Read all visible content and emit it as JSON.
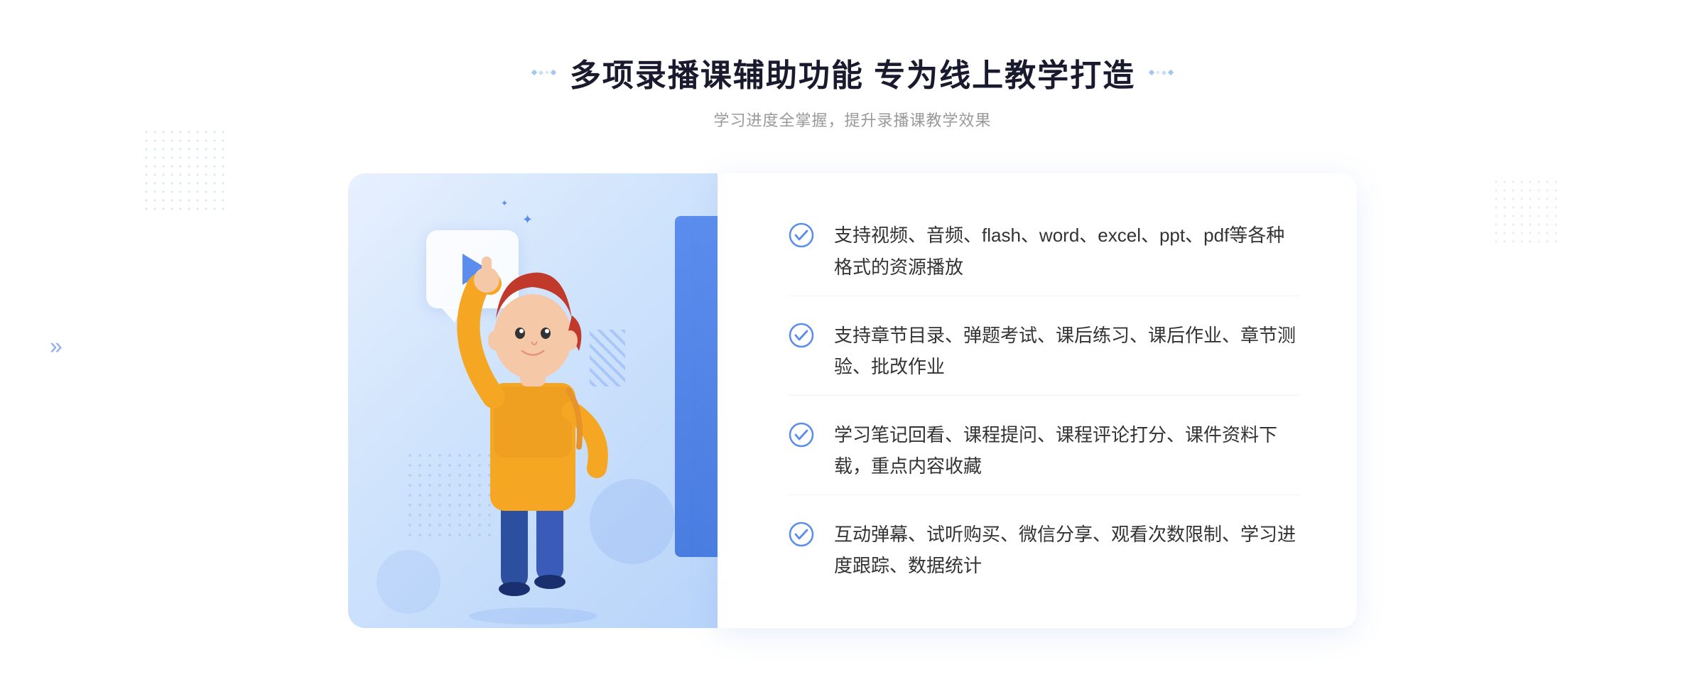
{
  "header": {
    "title": "多项录播课辅助功能 专为线上教学打造",
    "subtitle": "学习进度全掌握，提升录播课教学效果",
    "title_decorator_left": "❖",
    "title_decorator_right": "❖"
  },
  "features": [
    {
      "id": "feature-1",
      "text": "支持视频、音频、flash、word、excel、ppt、pdf等各种格式的资源播放"
    },
    {
      "id": "feature-2",
      "text": "支持章节目录、弹题考试、课后练习、课后作业、章节测验、批改作业"
    },
    {
      "id": "feature-3",
      "text": "学习笔记回看、课程提问、课程评论打分、课件资料下载，重点内容收藏"
    },
    {
      "id": "feature-4",
      "text": "互动弹幕、试听购买、微信分享、观看次数限制、学习进度跟踪、数据统计"
    }
  ],
  "icons": {
    "check": "check-circle-icon",
    "play": "play-icon",
    "arrow_left": "«"
  },
  "colors": {
    "primary": "#5b8dee",
    "title": "#1a1a2e",
    "text": "#333333",
    "subtitle": "#999999",
    "bg_card": "#ffffff",
    "bg_illus": "#dce9fc"
  }
}
